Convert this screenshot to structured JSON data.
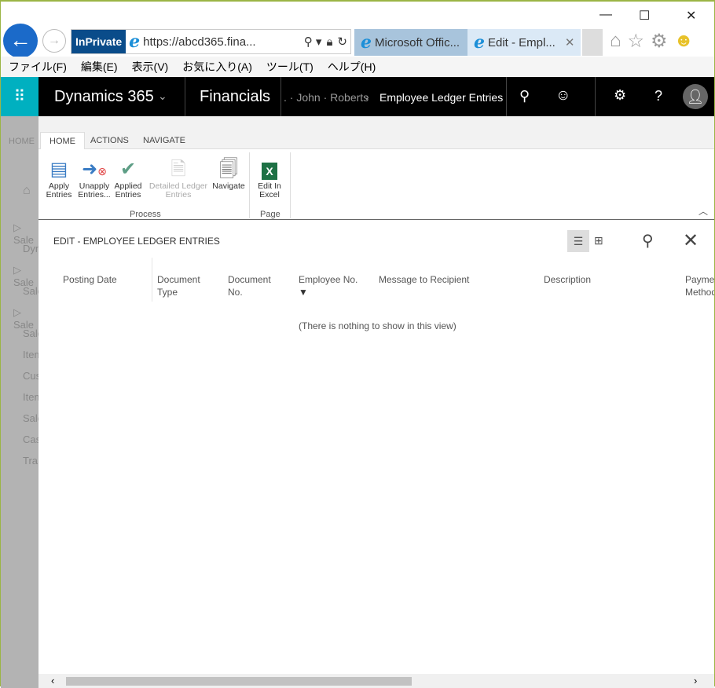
{
  "browser": {
    "address": "https://abcd365.fina...",
    "inprivate": "InPrivate",
    "tabs": [
      {
        "label": "Microsoft Offic..."
      },
      {
        "label": "Edit - Empl..."
      }
    ],
    "window_controls": [
      "—",
      "☐",
      "✕"
    ]
  },
  "menu": [
    "ファイル(F)",
    "編集(E)",
    "表示(V)",
    "お気に入り(A)",
    "ツール(T)",
    "ヘルプ(H)"
  ],
  "topbar": {
    "product": "Dynamics 365",
    "app": "Financials",
    "breadcrumb_prev": ". · John · Roberts",
    "breadcrumb_current": "Employee Ledger Entries"
  },
  "background": {
    "tab": "HOME",
    "items": [
      "Sale",
      "Dyn",
      "Sale",
      "Sale",
      "Sale",
      "Sale",
      "Item",
      "Cus",
      "Item",
      "Sale",
      "Cas",
      "Tra"
    ]
  },
  "ribbon": {
    "tabs": [
      "HOME",
      "ACTIONS",
      "NAVIGATE"
    ],
    "buttons": [
      {
        "label1": "Apply",
        "label2": "Entries"
      },
      {
        "label1": "Unapply",
        "label2": "Entries..."
      },
      {
        "label1": "Applied",
        "label2": "Entries"
      },
      {
        "label1": "Detailed Ledger",
        "label2": "Entries"
      },
      {
        "label1": "Navigate",
        "label2": ""
      },
      {
        "label1": "Edit In",
        "label2": "Excel"
      }
    ],
    "groups": [
      "Process",
      "Page"
    ]
  },
  "page": {
    "title": "EDIT - EMPLOYEE LEDGER ENTRIES",
    "columns": [
      {
        "l1": "Posting Date",
        "l2": ""
      },
      {
        "l1": "Document",
        "l2": "Type"
      },
      {
        "l1": "Document",
        "l2": "No."
      },
      {
        "l1": "Employee No.",
        "l2": ""
      },
      {
        "l1": "Message to Recipient",
        "l2": ""
      },
      {
        "l1": "Description",
        "l2": ""
      },
      {
        "l1": "Paymen",
        "l2": "Method"
      }
    ],
    "empty": "(There is nothing to show in this view)"
  }
}
